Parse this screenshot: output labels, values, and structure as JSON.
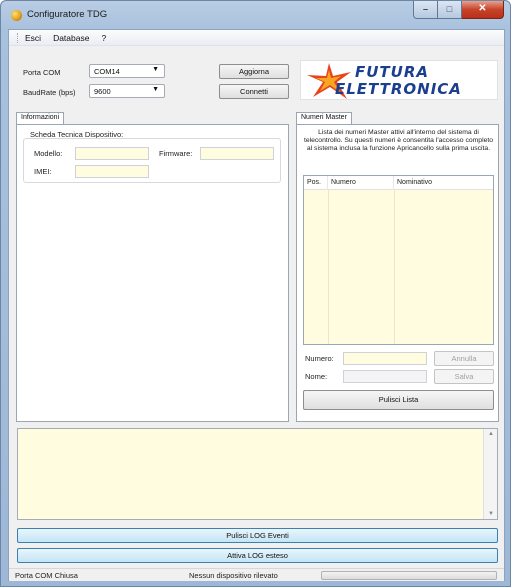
{
  "window": {
    "title": "Configuratore TDG",
    "min_glyph": "–",
    "max_glyph": "□",
    "close_glyph": "✕"
  },
  "menu": {
    "items": [
      "Esci",
      "Database",
      "?"
    ]
  },
  "connection": {
    "porta_label": "Porta COM",
    "porta_value": "COM14",
    "baud_label": "BaudRate (bps)",
    "baud_value": "9600",
    "aggiorna_label": "Aggiorna",
    "connetti_label": "Connetti"
  },
  "logo": {
    "line1": "FUTURA",
    "line2": "ELETTRONICA",
    "colors": {
      "text": "#1b3f8f",
      "star_outer": "#e8431c",
      "star_inner": "#f8a51f"
    }
  },
  "informazioni": {
    "tab_label": "Informazioni",
    "group_title": "Scheda Tecnica Dispositivo:",
    "modello_label": "Modello:",
    "modello_value": "",
    "firmware_label": "Firmware:",
    "firmware_value": "",
    "imei_label": "IMEI:",
    "imei_value": ""
  },
  "numeri_master": {
    "tab_label": "Numeri Master",
    "description": "Lista dei numeri Master attivi all'interno del sistema di telecontrollo. Su questi numeri è consentita l'accesso completo al sistema inclusa la funzione Apricancello sulla prima uscita.",
    "columns": [
      "Pos.",
      "Numero",
      "Nominativo"
    ],
    "rows": [],
    "numero_label": "Numero:",
    "numero_value": "",
    "nome_label": "Nome:",
    "nome_value": "",
    "annulla_label": "Annulla",
    "salva_label": "Salva",
    "pulisci_lista_label": "Pulisci Lista"
  },
  "log": {
    "content": "",
    "pulisci_log_label": "Pulisci LOG Eventi",
    "attiva_log_label": "Attiva LOG esteso"
  },
  "status": {
    "port_status": "Porta COM Chiusa",
    "device_status": "Nessun dispositivo rilevato",
    "progress": 0
  }
}
